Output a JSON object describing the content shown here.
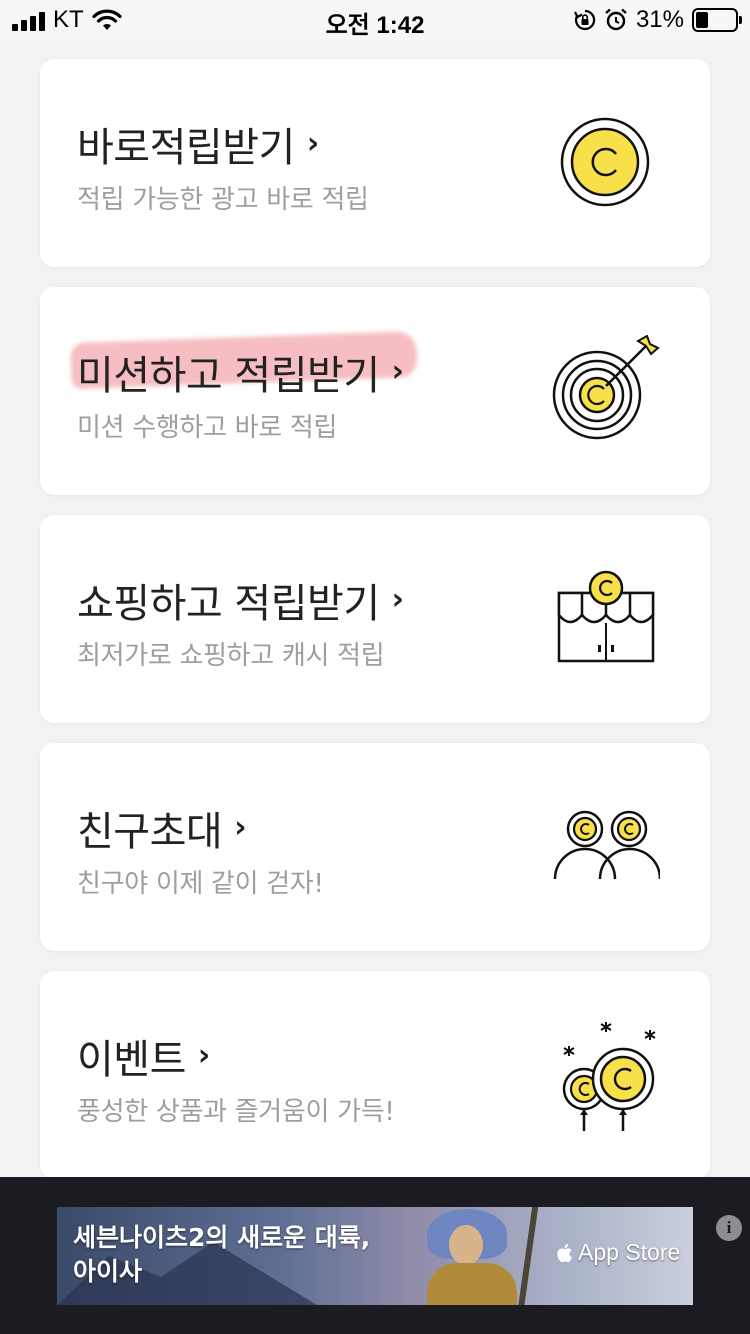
{
  "status_bar": {
    "carrier": "KT",
    "time": "오전 1:42",
    "battery_percent": "31%",
    "battery_level": 0.31,
    "icons": [
      "signal-icon",
      "wifi-icon",
      "orientation-lock-icon",
      "alarm-icon",
      "battery-icon"
    ]
  },
  "cards": [
    {
      "title": "바로적립받기",
      "subtitle": "적립 가능한 광고 바로 적립",
      "icon": "coin-icon"
    },
    {
      "title": "미션하고 적립받기",
      "subtitle": "미션 수행하고 바로 적립",
      "icon": "target-icon",
      "highlighted": true
    },
    {
      "title": "쇼핑하고 적립받기",
      "subtitle": "최저가로 쇼핑하고 캐시 적립",
      "icon": "shop-icon"
    },
    {
      "title": "친구초대",
      "subtitle": "친구야 이제 같이 걷자!",
      "icon": "friends-icon"
    },
    {
      "title": "이벤트",
      "subtitle": "풍성한 상품과 즐거움이 가득!",
      "icon": "balloons-icon"
    }
  ],
  "chevron": "›",
  "ad": {
    "text": "세븐나이츠2의 새로운 대륙,\n아이사",
    "line1": "세븐나이츠2의 새로운 대륙,",
    "line2": "아이사",
    "store_label": "App Store",
    "info_label": "i"
  },
  "colors": {
    "coin_yellow": "#f7e04a",
    "highlight": "#eb6e78",
    "card_bg": "#ffffff",
    "page_bg": "#f2f2f2",
    "subtitle_gray": "#9e9e9e"
  }
}
